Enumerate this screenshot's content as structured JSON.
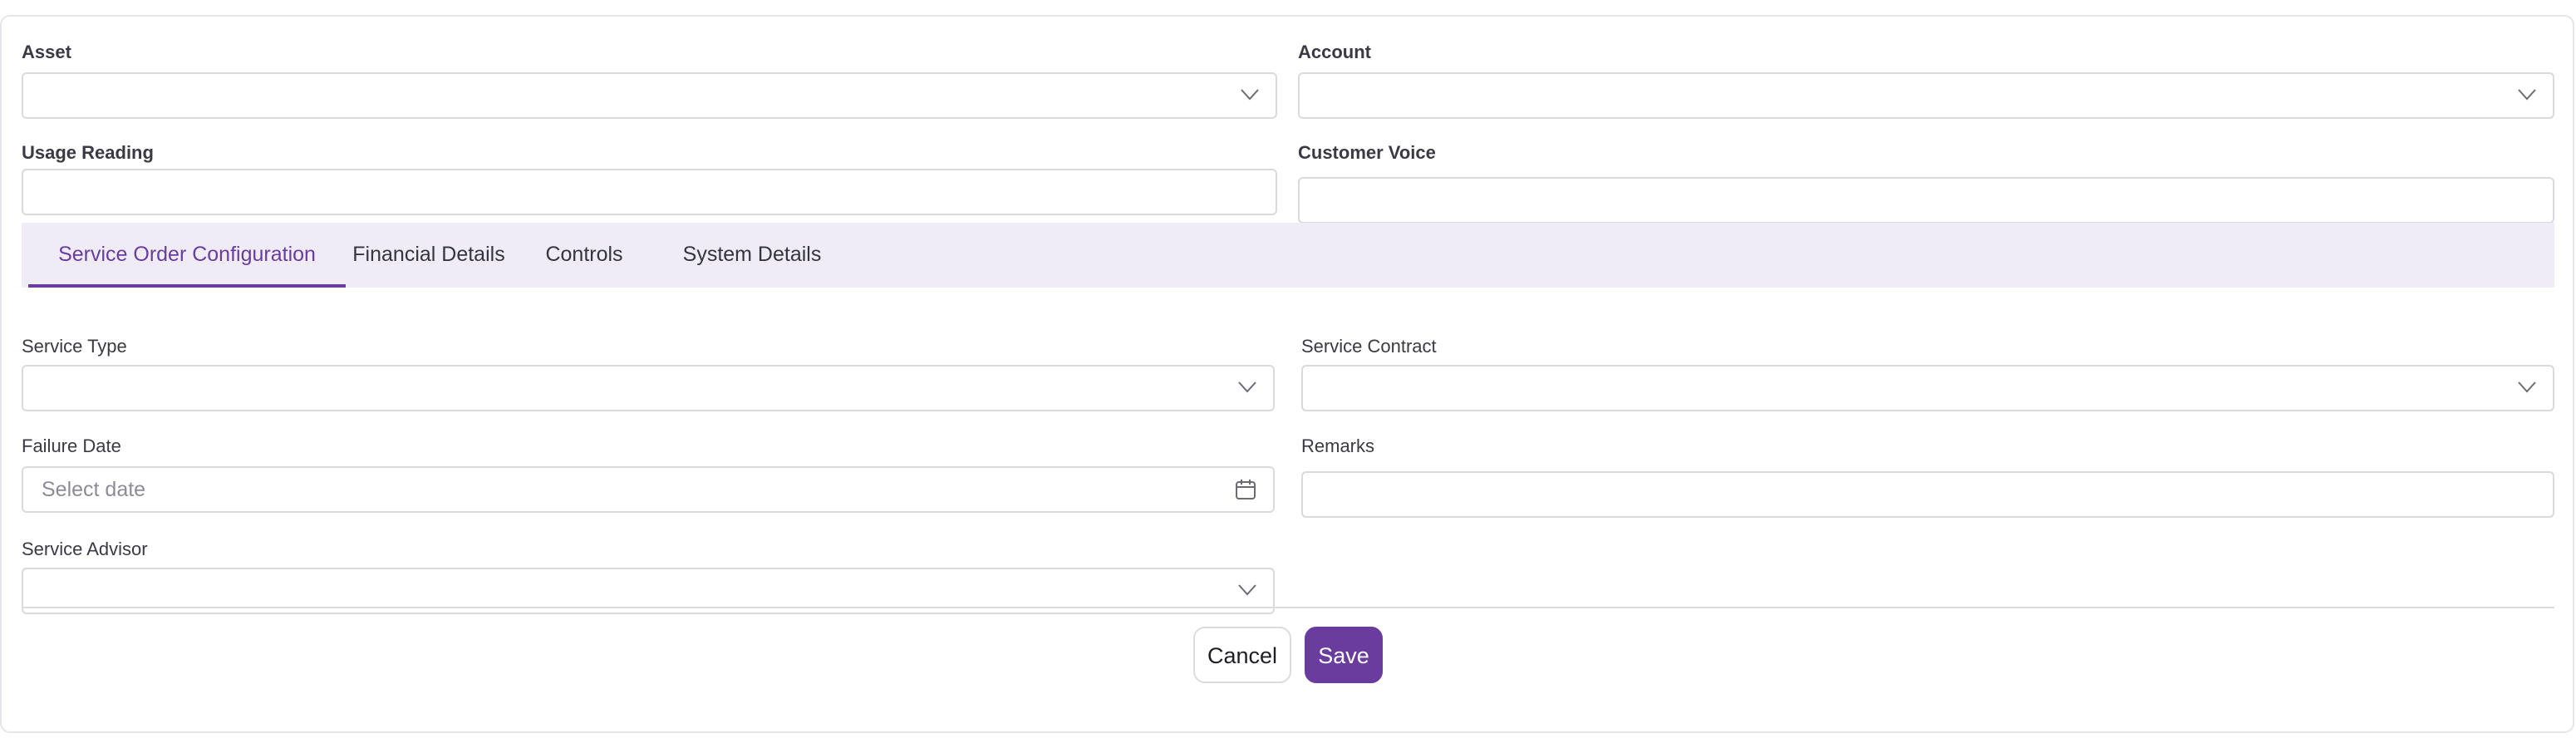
{
  "form": {
    "asset": {
      "label": "Asset",
      "value": ""
    },
    "account": {
      "label": "Account",
      "value": ""
    },
    "usage_reading": {
      "label": "Usage Reading",
      "value": ""
    },
    "customer_voice": {
      "label": "Customer Voice",
      "value": ""
    }
  },
  "tabs": [
    {
      "label": "Service Order Configuration",
      "active": true
    },
    {
      "label": "Financial Details",
      "active": false
    },
    {
      "label": "Controls",
      "active": false
    },
    {
      "label": "System Details",
      "active": false
    }
  ],
  "config": {
    "service_type": {
      "label": "Service Type",
      "value": ""
    },
    "service_contract": {
      "label": "Service Contract",
      "value": ""
    },
    "failure_date": {
      "label": "Failure Date",
      "placeholder": "Select date"
    },
    "remarks": {
      "label": "Remarks",
      "value": ""
    },
    "service_advisor": {
      "label": "Service Advisor",
      "value": ""
    }
  },
  "actions": {
    "cancel": "Cancel",
    "save": "Save"
  },
  "colors": {
    "accent": "#6a3c9e",
    "tab_bar_bg": "#efecf5",
    "border": "#d9d9de"
  },
  "icons": {
    "dropdown": "chevron-down-icon",
    "date": "calendar-icon"
  }
}
